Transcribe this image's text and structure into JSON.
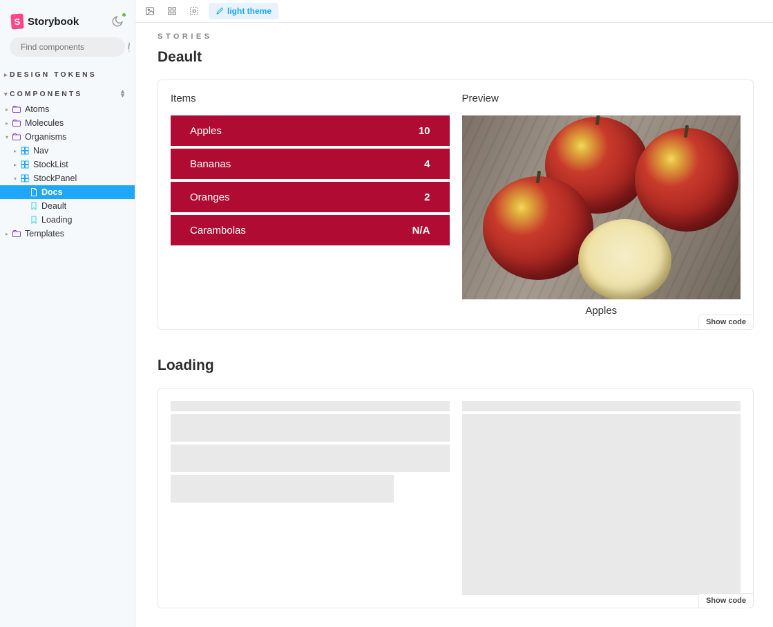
{
  "app": {
    "name": "Storybook"
  },
  "search": {
    "placeholder": "Find components",
    "shortcut": "/"
  },
  "sections": {
    "design_tokens": "DESIGN TOKENS",
    "components": "COMPONENTS"
  },
  "tree": {
    "atoms": "Atoms",
    "molecules": "Molecules",
    "organisms": "Organisms",
    "nav": "Nav",
    "stocklist": "StockList",
    "stockpanel": "StockPanel",
    "docs": "Docs",
    "deault": "Deault",
    "loading": "Loading",
    "templates": "Templates"
  },
  "toolbar": {
    "theme_label": "light theme"
  },
  "content": {
    "eyebrow": "STORIES",
    "story1_title": "Deault",
    "story2_title": "Loading",
    "items_label": "Items",
    "preview_label": "Preview",
    "preview_caption": "Apples",
    "stock": [
      {
        "name": "Apples",
        "value": "10"
      },
      {
        "name": "Bananas",
        "value": "4"
      },
      {
        "name": "Oranges",
        "value": "2"
      },
      {
        "name": "Carambolas",
        "value": "N/A"
      }
    ],
    "show_code": "Show code"
  }
}
